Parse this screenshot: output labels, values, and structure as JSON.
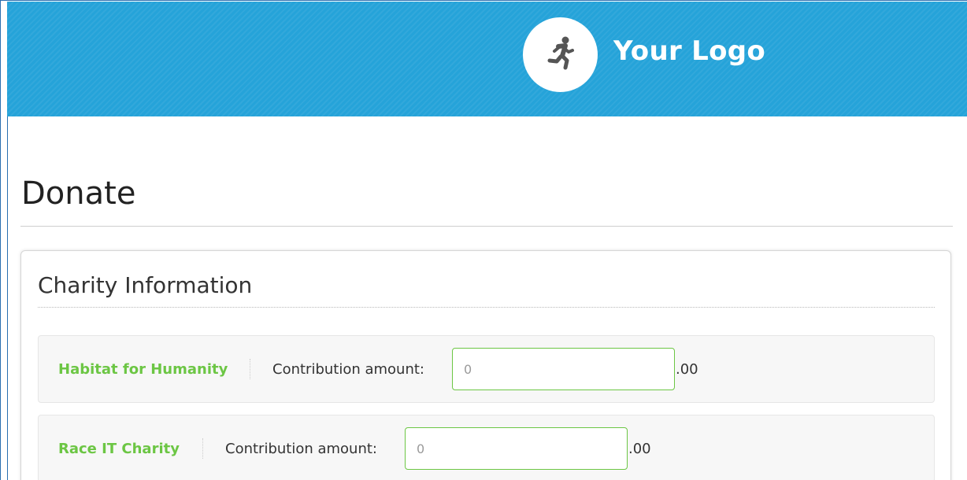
{
  "header": {
    "logo_text": "Your Logo",
    "logo_icon": "running-person-icon",
    "background_color": "#25a3d9"
  },
  "page": {
    "title": "Donate"
  },
  "panel": {
    "title": "Charity Information"
  },
  "charities": [
    {
      "name": "Habitat for Humanity",
      "contribution_label": "Contribution amount:",
      "placeholder": "0",
      "value": "",
      "cents_suffix": ".00"
    },
    {
      "name": "Race IT Charity",
      "contribution_label": "Contribution amount:",
      "placeholder": "0",
      "value": "",
      "cents_suffix": ".00"
    }
  ],
  "colors": {
    "accent_green": "#6cc644",
    "text_dark": "#222222"
  }
}
